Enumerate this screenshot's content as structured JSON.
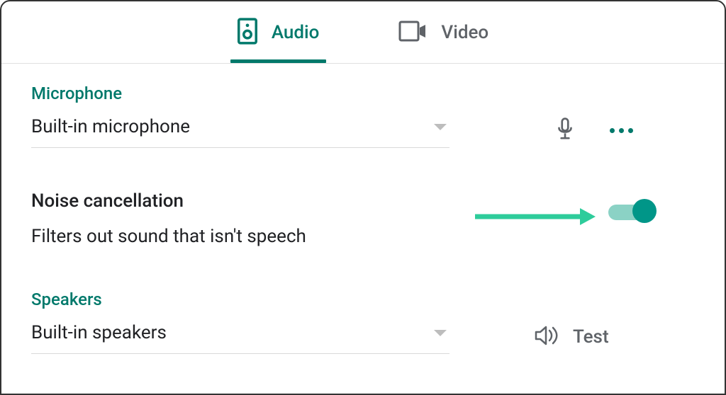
{
  "accentColor": "#00796b",
  "tabs": {
    "audio": {
      "label": "Audio",
      "active": true
    },
    "video": {
      "label": "Video",
      "active": false
    }
  },
  "microphone": {
    "section_title": "Microphone",
    "selected": "Built-in microphone"
  },
  "noise_cancellation": {
    "title": "Noise cancellation",
    "description": "Filters out sound that isn't speech",
    "enabled": true
  },
  "speakers": {
    "section_title": "Speakers",
    "selected": "Built-in speakers",
    "test_label": "Test"
  }
}
